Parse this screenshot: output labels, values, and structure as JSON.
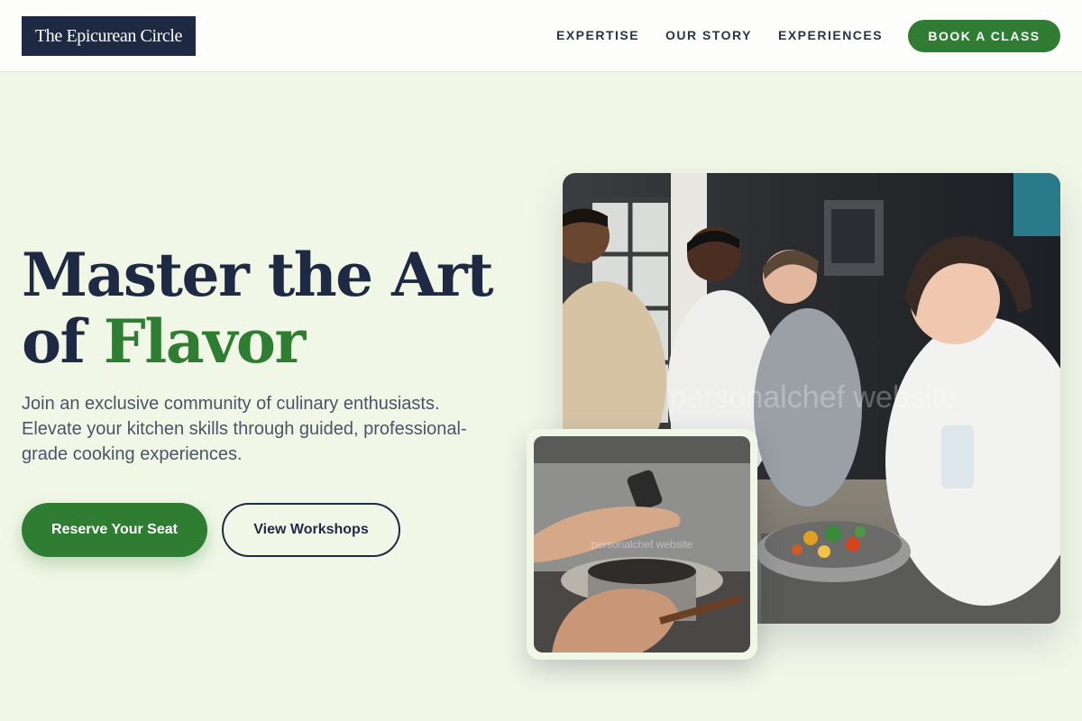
{
  "brand": {
    "name": "The Epicurean Circle"
  },
  "nav": {
    "links": [
      {
        "label": "EXPERTISE"
      },
      {
        "label": "OUR STORY"
      },
      {
        "label": "EXPERIENCES"
      }
    ],
    "cta_label": "BOOK A CLASS"
  },
  "hero": {
    "headline_part1": "Master the Art of ",
    "headline_accent": "Flavor",
    "subtitle": "Join an exclusive community of culinary enthusiasts. Elevate your kitchen skills through guided, professional-grade cooking experiences.",
    "primary_button": "Reserve Your Seat",
    "secondary_button": "View Workshops"
  },
  "images": {
    "main": {
      "alt": "Group of people cooking together in a kitchen",
      "watermark": "personalchef website"
    },
    "small": {
      "alt": "Hands cooking over a pot on the stove",
      "watermark": "personalchef website"
    }
  },
  "colors": {
    "background": "#f1f7e7",
    "navy": "#1e2a44",
    "green": "#2e7d32",
    "text_muted": "#4a5568"
  }
}
